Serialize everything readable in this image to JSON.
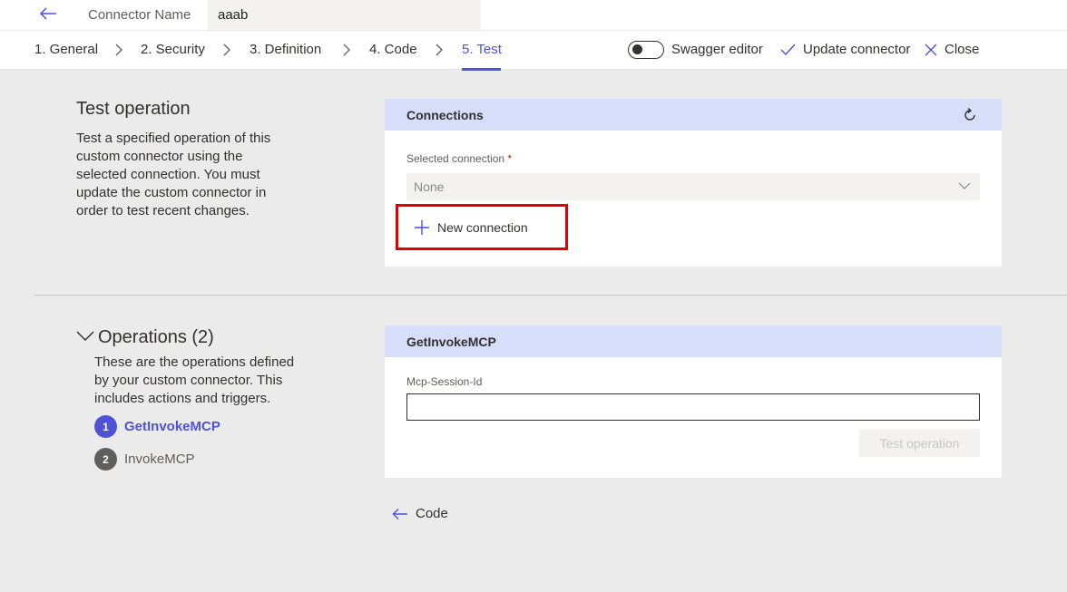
{
  "header": {
    "connector_label": "Connector Name",
    "connector_value": "aaab"
  },
  "nav": {
    "tabs": [
      {
        "label": "1. General"
      },
      {
        "label": "2. Security"
      },
      {
        "label": "3. Definition"
      },
      {
        "label": "4. Code"
      },
      {
        "label": "5. Test"
      }
    ],
    "active_tab": "5. Test",
    "swagger_label": "Swagger editor",
    "swagger_on": false,
    "update_label": "Update connector",
    "close_label": "Close"
  },
  "test_operation": {
    "title": "Test operation",
    "description": "Test a specified operation of this custom connector using the selected connection. You must update the custom connector in order to test recent changes."
  },
  "connections": {
    "header": "Connections",
    "selected_label": "Selected connection",
    "required_mark": "*",
    "selected_value": "None",
    "new_connection_label": "New connection"
  },
  "operations": {
    "title": "Operations (2)",
    "description": "These are the operations defined by your custom connector. This includes actions and triggers.",
    "items": [
      {
        "num": "1",
        "name": "GetInvokeMCP",
        "active": true
      },
      {
        "num": "2",
        "name": "InvokeMCP",
        "active": false
      }
    ]
  },
  "operation_panel": {
    "header": "GetInvokeMCP",
    "field_label": "Mcp-Session-Id",
    "field_value": "",
    "test_button": "Test operation"
  },
  "footer": {
    "back_label": "Code"
  },
  "colors": {
    "accent": "#4f52d6",
    "panel_header": "#d7defa",
    "highlight_box": "#e00000",
    "inactive_step": "#605e5c"
  }
}
